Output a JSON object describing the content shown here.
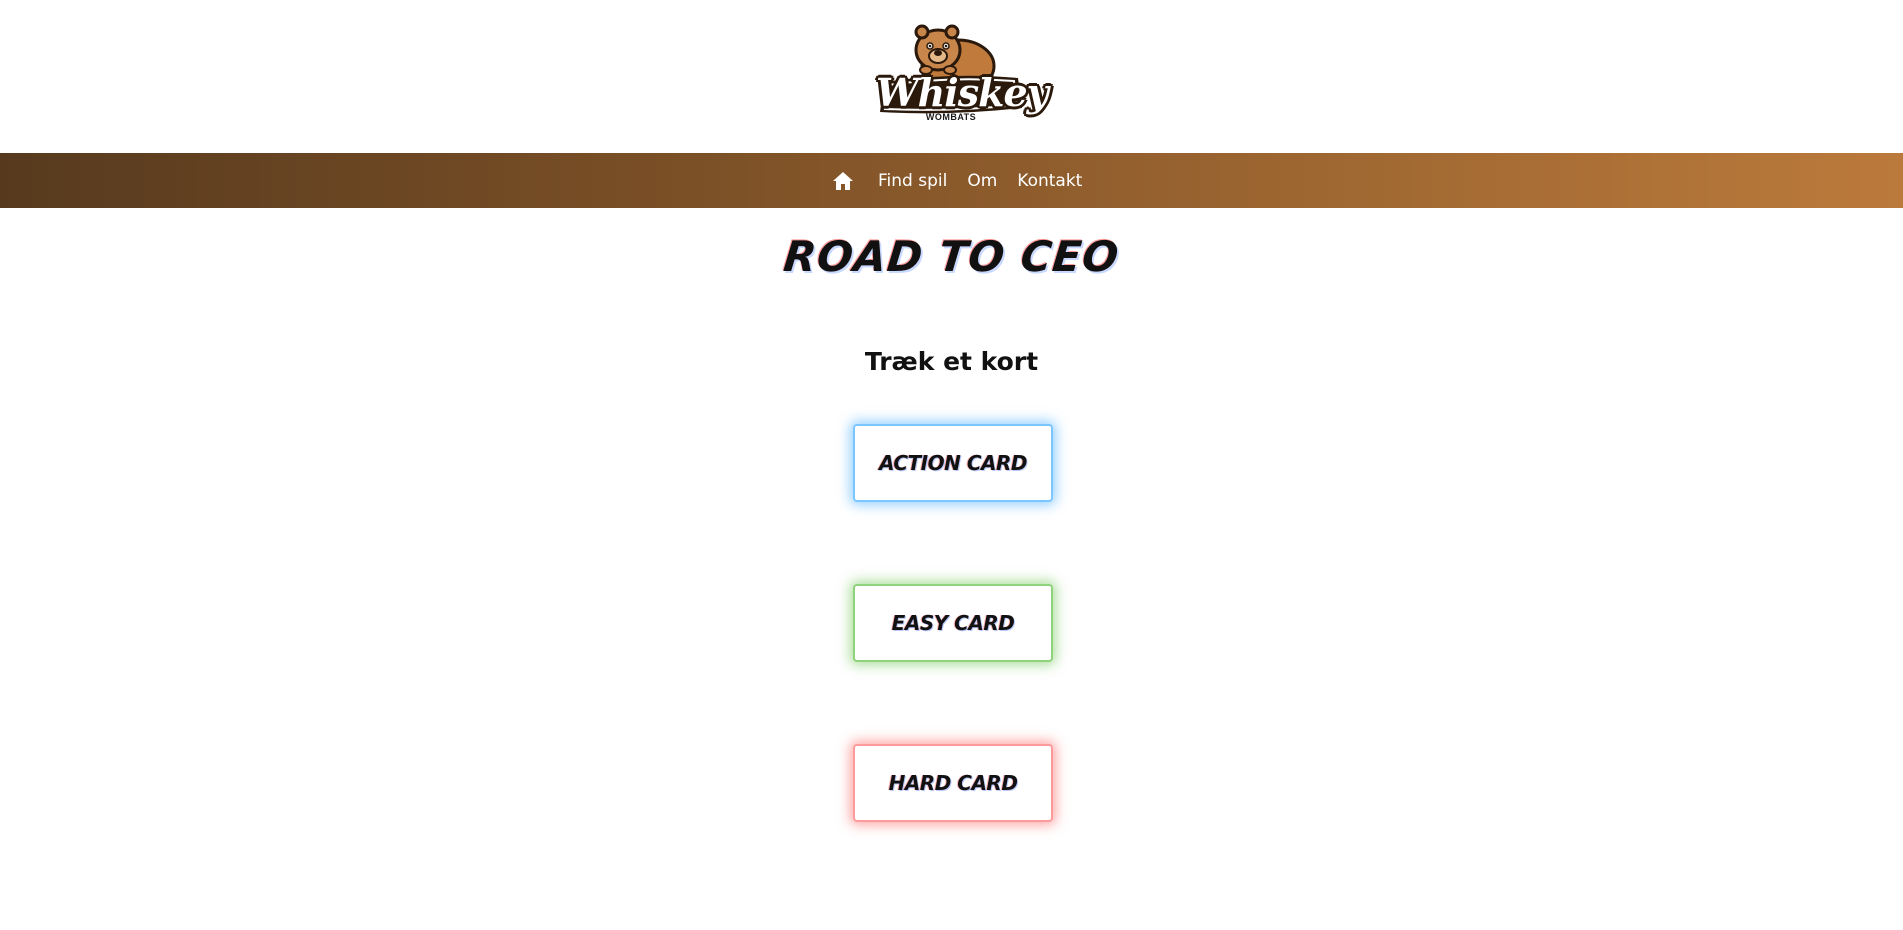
{
  "header": {
    "logo": {
      "title": "Whiskey",
      "subtitle": "WOMBATS",
      "icon": "wombat-mascot-icon"
    }
  },
  "nav": {
    "home_icon": "home-icon",
    "links": [
      {
        "label": "Find spil"
      },
      {
        "label": "Om"
      },
      {
        "label": "Kontakt"
      }
    ],
    "gradient_colors": [
      "#573a1e",
      "#bb7a3b"
    ]
  },
  "main": {
    "title": "ROAD TO CEO",
    "subtitle": "Træk et kort",
    "cards": [
      {
        "label": "ACTION CARD",
        "accent": "#40aaff"
      },
      {
        "label": "EASY CARD",
        "accent": "#5abe3c"
      },
      {
        "label": "HARD CARD",
        "accent": "#ff5050"
      }
    ]
  }
}
